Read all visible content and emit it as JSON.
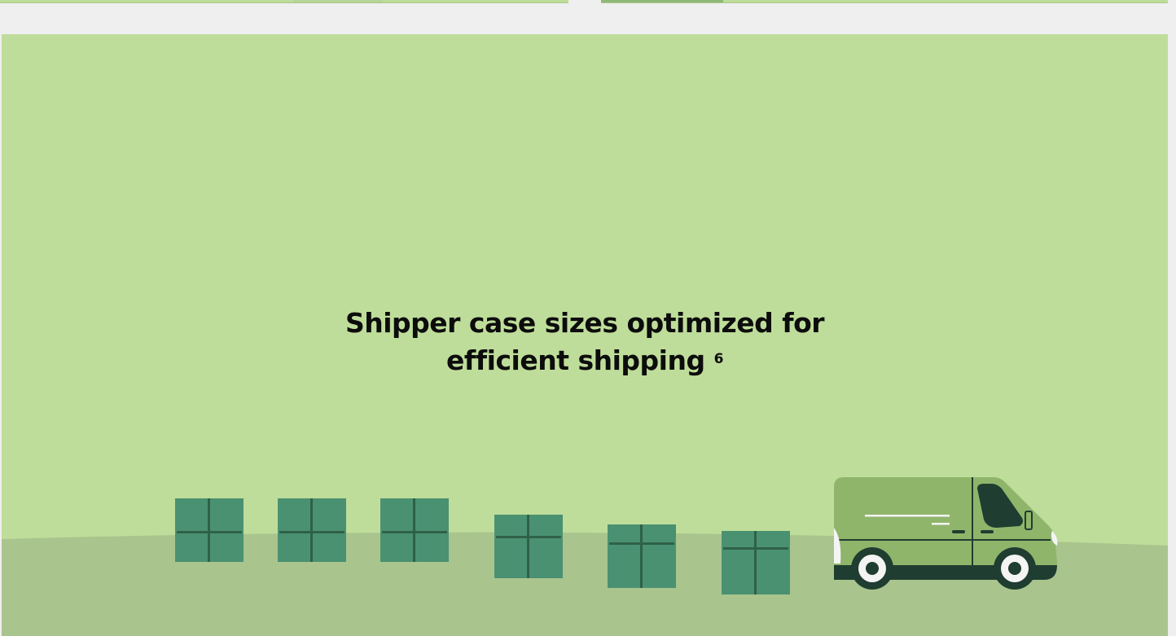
{
  "hero": {
    "title_line1": "Shipper case sizes optimized for",
    "title_line2": "efficient shipping",
    "footnote": "6"
  },
  "colors": {
    "sky": "#bfdd9a",
    "ground": "#a9c48d",
    "box": "#4a9172",
    "box_tape": "#2f6147",
    "van_body": "#8fb56a",
    "van_dark": "#1f3d30",
    "page_bg": "#efefef"
  },
  "illustration": {
    "box_count": 6,
    "vehicle": "delivery-van"
  }
}
